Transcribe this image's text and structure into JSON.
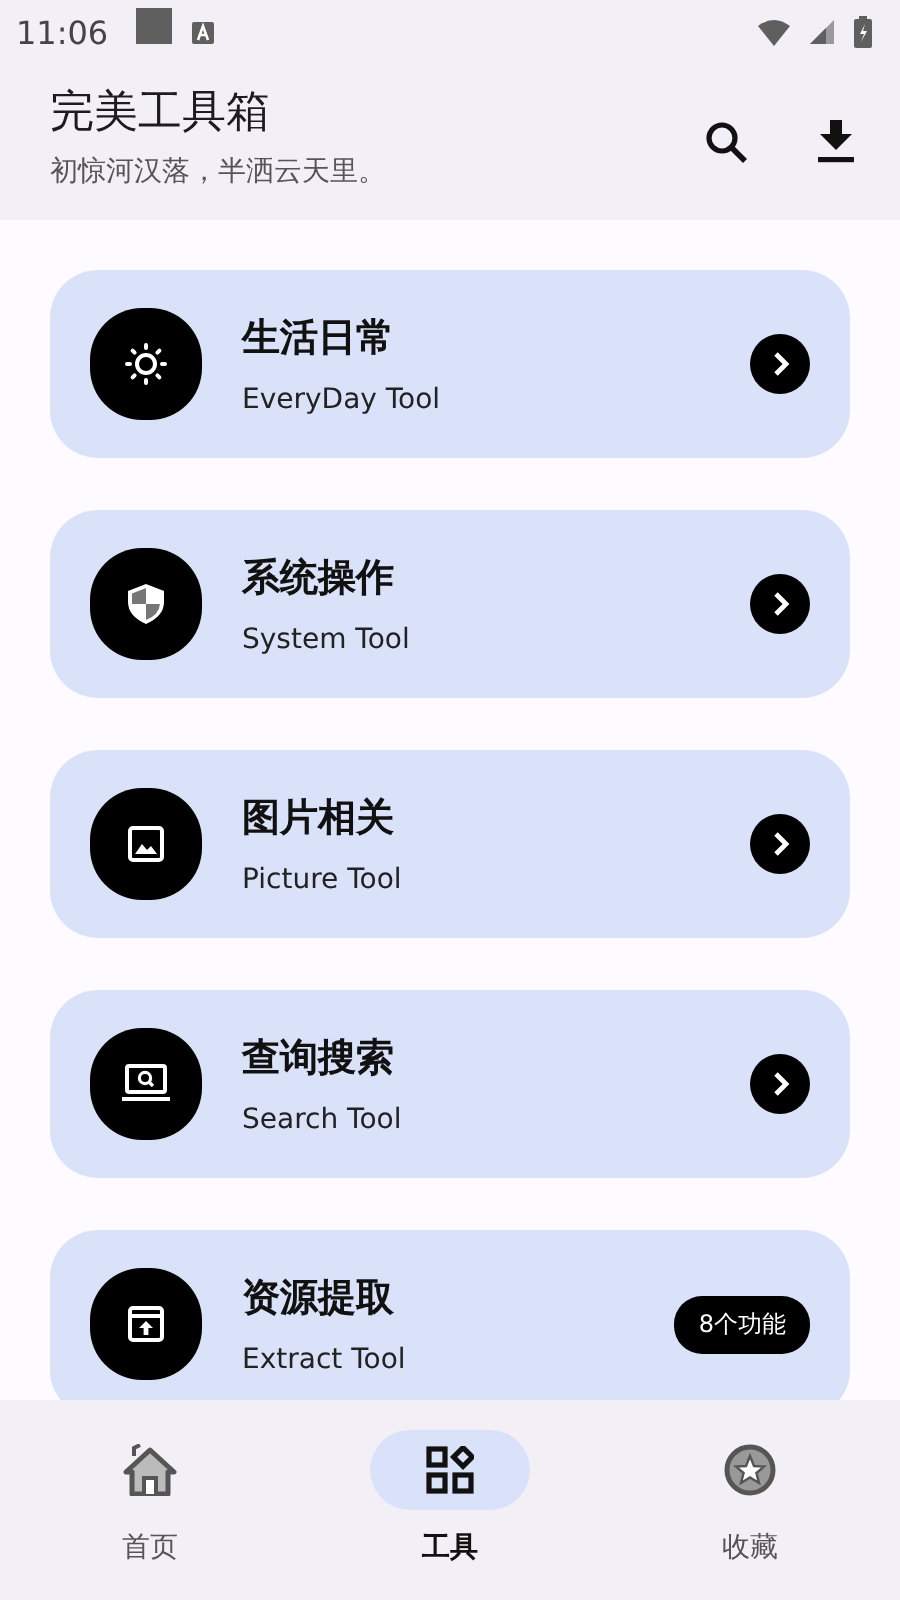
{
  "status_bar": {
    "time": "11:06"
  },
  "app_bar": {
    "title": "完美工具箱",
    "subtitle": "初惊河汉落，半洒云天里。"
  },
  "categories": [
    {
      "title": "生活日常",
      "subtitle": "EveryDay Tool",
      "kind": "arrow"
    },
    {
      "title": "系统操作",
      "subtitle": "System Tool",
      "kind": "arrow"
    },
    {
      "title": "图片相关",
      "subtitle": "Picture Tool",
      "kind": "arrow"
    },
    {
      "title": "查询搜索",
      "subtitle": "Search Tool",
      "kind": "arrow"
    },
    {
      "title": "资源提取",
      "subtitle": "Extract Tool",
      "kind": "badge",
      "badge": "8个功能"
    }
  ],
  "nav": [
    {
      "label": "首页",
      "selected": false
    },
    {
      "label": "工具",
      "selected": true
    },
    {
      "label": "收藏",
      "selected": false
    }
  ]
}
